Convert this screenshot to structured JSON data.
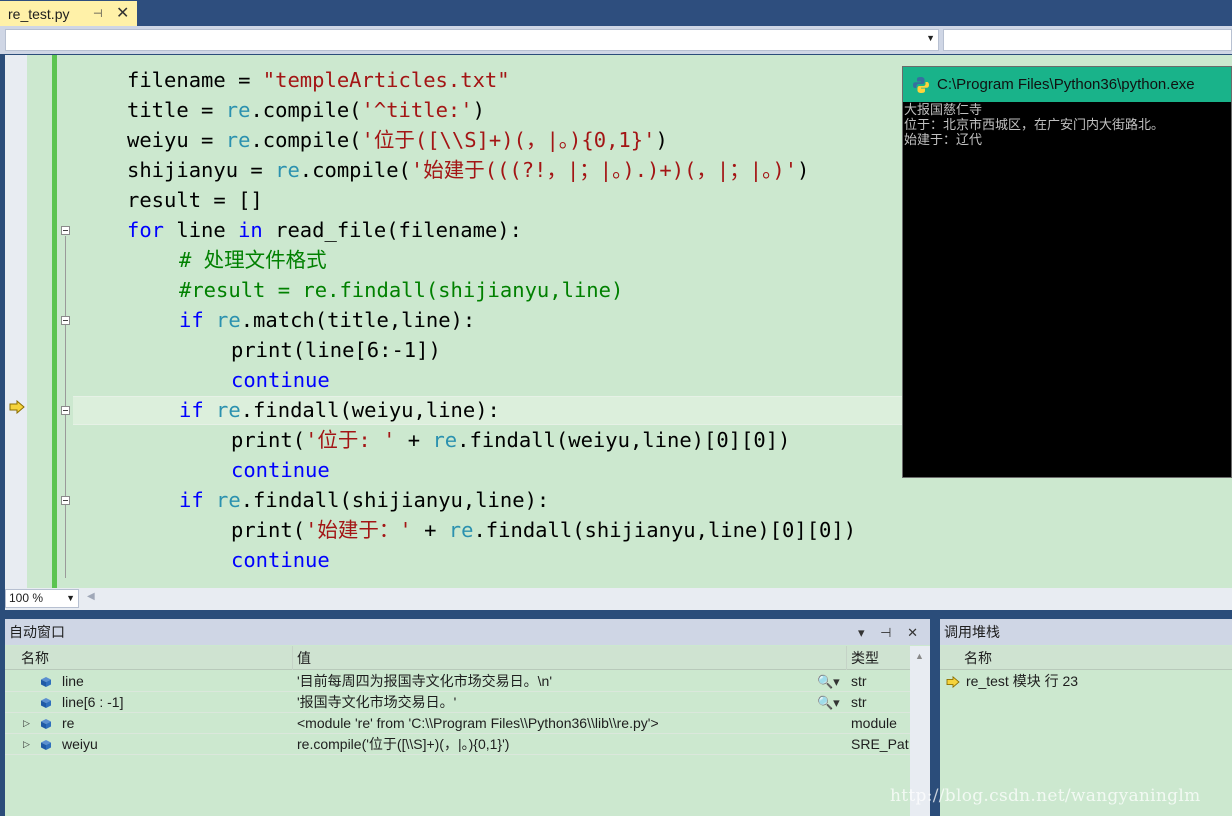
{
  "tab": {
    "title": "re_test.py",
    "pin_glyph": "⊣",
    "close_glyph": "✕"
  },
  "navbar": {
    "left_value": "",
    "right_value": ""
  },
  "code_lines": [
    {
      "indent": 1,
      "tokens": [
        [
          "t",
          "filename = "
        ],
        [
          "str",
          "\"templeArticles.txt\""
        ]
      ]
    },
    {
      "indent": 1,
      "tokens": [
        [
          "t",
          "title = "
        ],
        [
          "re",
          "re"
        ],
        [
          "t",
          ".compile("
        ],
        [
          "str",
          "'^title:'"
        ],
        [
          "t",
          ")"
        ]
      ]
    },
    {
      "indent": 1,
      "tokens": [
        [
          "t",
          "weiyu = "
        ],
        [
          "re",
          "re"
        ],
        [
          "t",
          ".compile("
        ],
        [
          "str",
          "'位于([\\\\S]+)(，|。){0,1}'"
        ],
        [
          "t",
          ")"
        ]
      ]
    },
    {
      "indent": 1,
      "tokens": [
        [
          "t",
          "shijianyu = "
        ],
        [
          "re",
          "re"
        ],
        [
          "t",
          ".compile("
        ],
        [
          "str",
          "'始建于(((?!，|；|。).)+)(，|；|。)'"
        ],
        [
          "t",
          ")"
        ]
      ]
    },
    {
      "indent": 1,
      "tokens": [
        [
          "t",
          "result = []"
        ]
      ]
    },
    {
      "indent": 1,
      "tokens": [
        [
          "kw",
          "for"
        ],
        [
          "t",
          " line "
        ],
        [
          "kw",
          "in"
        ],
        [
          "t",
          " read_file(filename):"
        ]
      ]
    },
    {
      "indent": 2,
      "tokens": [
        [
          "cm",
          "# 处理文件格式"
        ]
      ]
    },
    {
      "indent": 2,
      "tokens": [
        [
          "cm",
          "#result = re.findall(shijianyu,line)"
        ]
      ]
    },
    {
      "indent": 2,
      "tokens": [
        [
          "kw",
          "if"
        ],
        [
          "t",
          " "
        ],
        [
          "re",
          "re"
        ],
        [
          "t",
          ".match(title,line):"
        ]
      ]
    },
    {
      "indent": 3,
      "tokens": [
        [
          "t",
          "print(line[6:-1])"
        ]
      ]
    },
    {
      "indent": 3,
      "tokens": [
        [
          "kw",
          "continue"
        ]
      ]
    },
    {
      "indent": 2,
      "tokens": [
        [
          "kw",
          "if"
        ],
        [
          "t",
          " "
        ],
        [
          "re",
          "re"
        ],
        [
          "t",
          ".findall(weiyu,line):"
        ]
      ]
    },
    {
      "indent": 3,
      "tokens": [
        [
          "t",
          "print("
        ],
        [
          "str",
          "'位于: '"
        ],
        [
          "t",
          " + "
        ],
        [
          "re",
          "re"
        ],
        [
          "t",
          ".findall(weiyu,line)[0][0])"
        ]
      ]
    },
    {
      "indent": 3,
      "tokens": [
        [
          "kw",
          "continue"
        ]
      ]
    },
    {
      "indent": 2,
      "tokens": [
        [
          "kw",
          "if"
        ],
        [
          "t",
          " "
        ],
        [
          "re",
          "re"
        ],
        [
          "t",
          ".findall(shijianyu,line):"
        ]
      ]
    },
    {
      "indent": 3,
      "tokens": [
        [
          "t",
          "print("
        ],
        [
          "str",
          "'始建于：'"
        ],
        [
          "t",
          " + "
        ],
        [
          "re",
          "re"
        ],
        [
          "t",
          ".findall(shijianyu,line)[0][0])"
        ]
      ]
    },
    {
      "indent": 3,
      "tokens": [
        [
          "kw",
          "continue"
        ]
      ]
    }
  ],
  "zoom": {
    "value": "100 %"
  },
  "console": {
    "title": "C:\\Program Files\\Python36\\python.exe",
    "lines": [
      "大报国慈仁寺",
      "位于：北京市西城区，在广安门内大街路北。",
      "始建于：辽代"
    ]
  },
  "autos": {
    "title": "自动窗口",
    "tools": "▾ ⊣ ✕",
    "columns": {
      "name": "名称",
      "value": "值",
      "type": "类型"
    },
    "rows": [
      {
        "expand": "",
        "name": "line",
        "value": "'目前每周四为报国寺文化市场交易日。\\n'",
        "search": "🔍▾",
        "type": "str"
      },
      {
        "expand": "",
        "name": "line[6 : -1]",
        "value": "'报国寺文化市场交易日。'",
        "search": "🔍▾",
        "type": "str"
      },
      {
        "expand": "▷",
        "name": "re",
        "value": "<module 're' from 'C:\\\\Program Files\\\\Python36\\\\lib\\\\re.py'>",
        "search": "",
        "type": "module"
      },
      {
        "expand": "▷",
        "name": "weiyu",
        "value": "re.compile('位于([\\\\S]+)(，|。){0,1}')",
        "search": "",
        "type": "SRE_Patte"
      }
    ]
  },
  "callstack": {
    "title": "调用堆栈",
    "columns": {
      "name": "名称"
    },
    "rows": [
      {
        "name": "re_test 模块 行 23"
      }
    ]
  },
  "watermark": "http://blog.csdn.net/wangyaninglm",
  "colors": {
    "editor_bg": "#cce8cf",
    "keyword": "#0000ff",
    "string": "#a31515",
    "module": "#2b91af",
    "comment": "#008000",
    "console_title": "#19b38a"
  },
  "icons": {
    "exec_arrow": "execution-pointer-icon",
    "python": "python-icon",
    "field": "field-cube-icon"
  }
}
